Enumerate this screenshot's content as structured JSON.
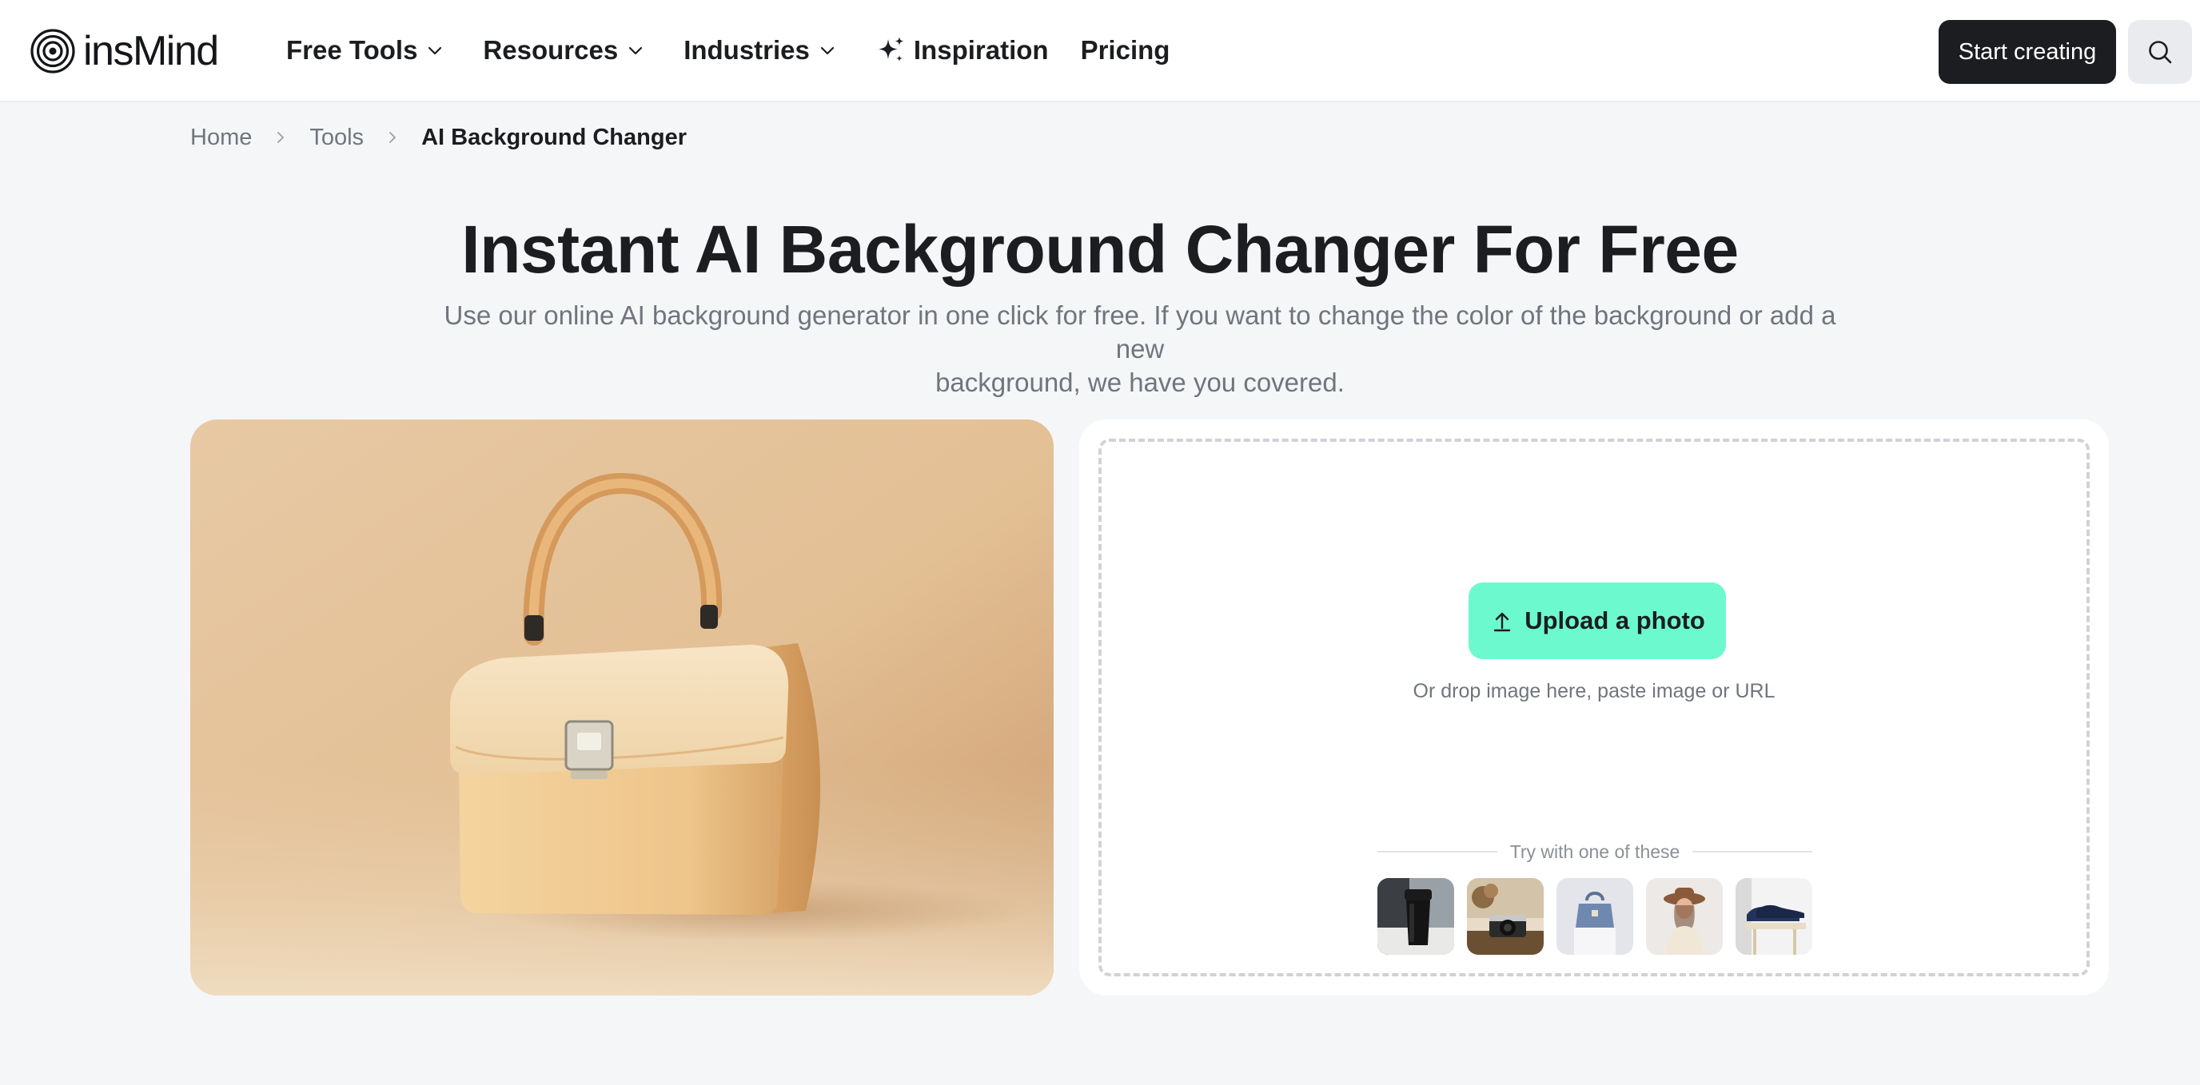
{
  "header": {
    "brand": "insMind",
    "nav": {
      "free_tools": "Free Tools",
      "resources": "Resources",
      "industries": "Industries",
      "inspiration": "Inspiration",
      "pricing": "Pricing"
    },
    "start_label": "Start creating"
  },
  "breadcrumb": {
    "home": "Home",
    "tools": "Tools",
    "current": "AI Background Changer"
  },
  "hero": {
    "title": "Instant AI Background Changer For Free",
    "subtitle_line1": "Use our online AI background generator in one click for free. If you want to change the color of the background or add a new",
    "subtitle_line2": "background, we have you covered."
  },
  "upload": {
    "button_label": "Upload a photo",
    "hint": "Or drop image here, paste image or URL",
    "try_label": "Try with one of these"
  },
  "icons": {
    "logo": "insmind-logo-icon",
    "chevron": "chevron-down-icon",
    "sparkle": "sparkle-icon",
    "search": "search-icon",
    "upload": "upload-arrow-icon",
    "breadcrumb_separator": "chevron-right-icon"
  },
  "colors": {
    "primary_dark": "#1c1d21",
    "accent_mint": "#6cf9cd",
    "page_bg": "#f5f6f8"
  }
}
